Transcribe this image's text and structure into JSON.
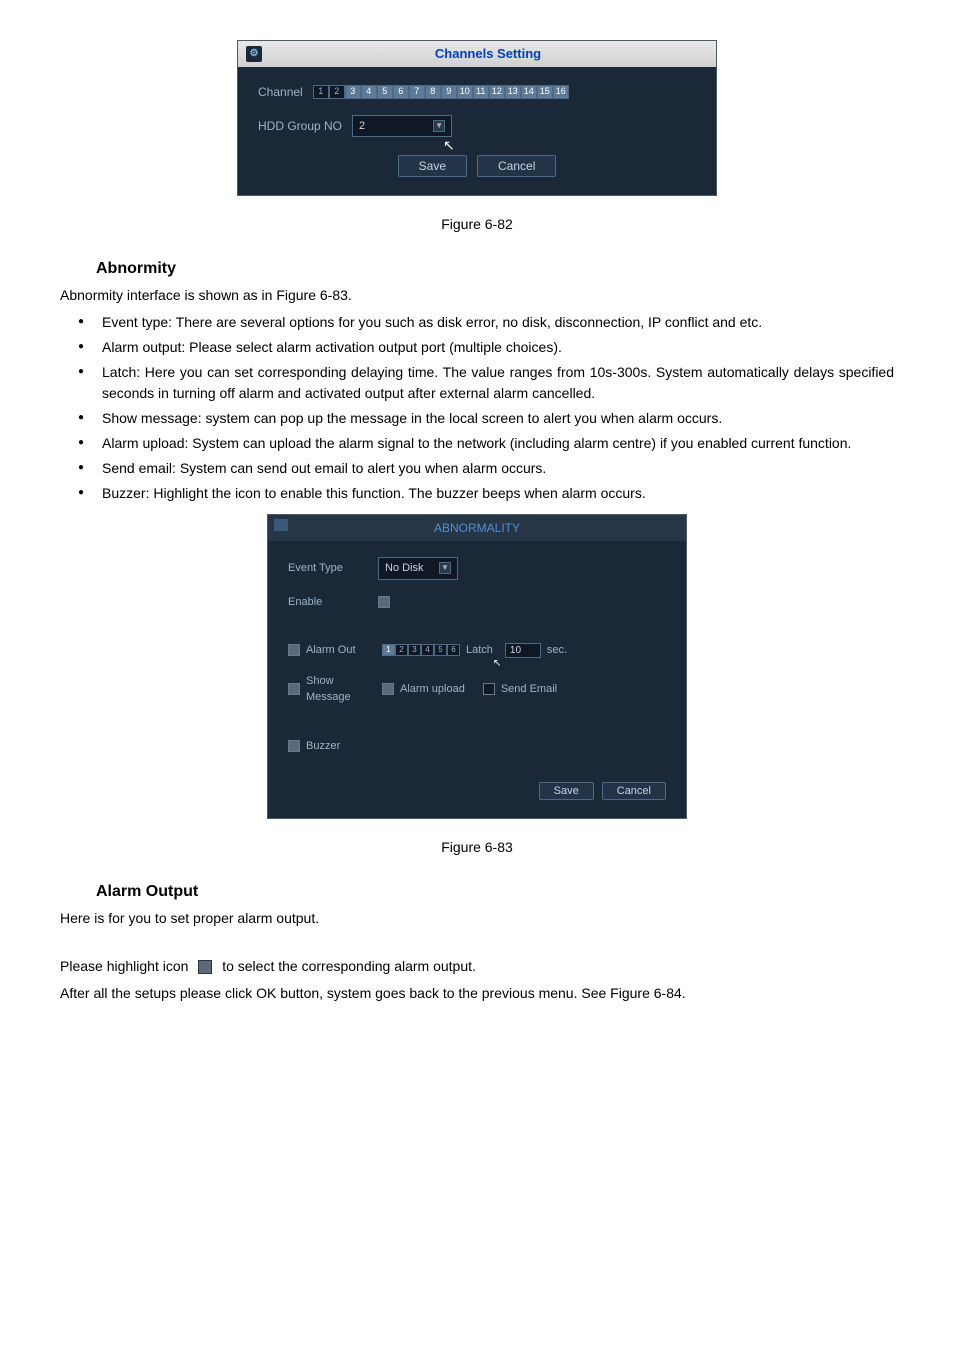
{
  "dialog1": {
    "title": "Channels Setting",
    "channel_label": "Channel",
    "channels": [
      "1",
      "2",
      "3",
      "4",
      "5",
      "6",
      "7",
      "8",
      "9",
      "10",
      "11",
      "12",
      "13",
      "14",
      "15",
      "16"
    ],
    "channels_selected": [
      false,
      false,
      true,
      true,
      true,
      true,
      true,
      true,
      true,
      true,
      true,
      true,
      true,
      true,
      true,
      true
    ],
    "hdd_label": "HDD Group NO",
    "hdd_value": "2",
    "save": "Save",
    "cancel": "Cancel"
  },
  "caption1": "Figure 6-82",
  "section1": "Abnormity",
  "para1": "Abnormity interface is shown as in Figure 6-83.",
  "bullets": [
    "Event type: There are several options for you such as disk error, no disk, disconnection, IP conflict and etc.",
    "Alarm output: Please select alarm activation output port (multiple choices).",
    "Latch: Here you can set corresponding delaying time. The value ranges from 10s-300s. System automatically delays specified seconds in turning off alarm and activated output after external alarm cancelled.",
    "Show message: system can pop up the message in the local screen to alert you when alarm occurs.",
    "Alarm upload: System can upload the alarm signal to the network (including alarm centre) if you enabled current function.",
    "Send email: System can send out email to alert you when alarm occurs.",
    "Buzzer: Highlight the icon to enable this function. The buzzer beeps when alarm occurs."
  ],
  "dialog2": {
    "title": "ABNORMALITY",
    "event_type_label": "Event Type",
    "event_type_value": "No Disk",
    "enable_label": "Enable",
    "alarm_out_label": "Alarm Out",
    "alarm_outs": [
      "1",
      "2",
      "3",
      "4",
      "5",
      "6"
    ],
    "alarm_outs_selected": [
      true,
      false,
      false,
      false,
      false,
      false
    ],
    "latch_label": "Latch",
    "latch_value": "10",
    "sec_label": "sec.",
    "show_message_label": "Show Message",
    "alarm_upload_label": "Alarm upload",
    "send_email_label": "Send Email",
    "buzzer_label": "Buzzer",
    "save": "Save",
    "cancel": "Cancel"
  },
  "caption2": "Figure 6-83",
  "section2": "Alarm Output",
  "para2": "Here is for you to set proper alarm output.",
  "para3a": "Please highlight icon",
  "para3b": "to select the corresponding alarm output.",
  "para4": "After all the setups please click OK button, system goes back to the previous menu. See Figure 6-84."
}
